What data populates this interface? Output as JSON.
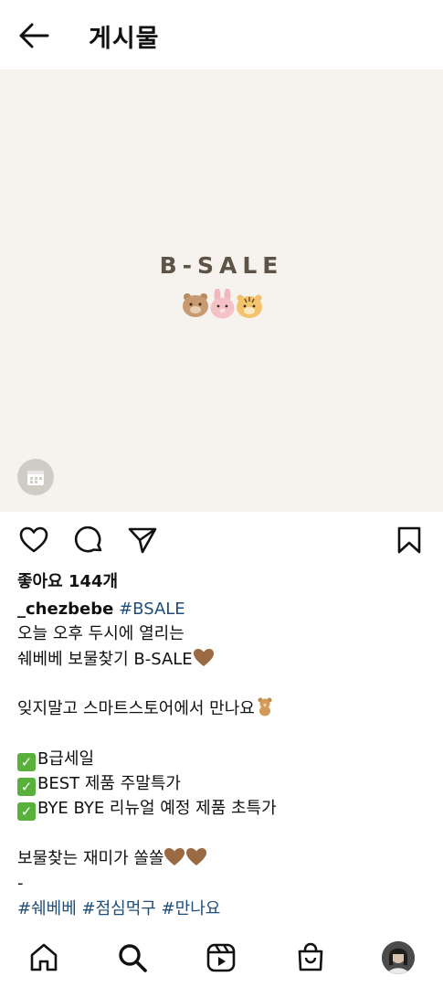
{
  "header": {
    "title": "게시물"
  },
  "post": {
    "image_text": "B-SALE",
    "likes": "좋아요 144개",
    "caption": {
      "username": "_chezbebe",
      "first_tag": "#BSALE",
      "line2": "오늘 오후 두시에 열리는",
      "line3": "쉐베베 보물찾기 B-SALE",
      "line5": "잊지말고 스마트스토어에서 만나요",
      "line7": "B급세일",
      "line8": "BEST 제품 주말특가",
      "line9": "BYE BYE 리뉴얼 예정 제품 초특가",
      "line11": "보물찾는 재미가 쏠쏠",
      "line12": "-",
      "tags": [
        "#쉐베베",
        "#점심먹구",
        "#만나요"
      ]
    }
  },
  "colors": {
    "background": "#ffffff",
    "image_bg": "#f6f3ee",
    "hashtag": "#1f4e79",
    "check": "#58b13a"
  },
  "icons": [
    "arrow-left-icon",
    "calendar-icon",
    "heart-icon",
    "comment-icon",
    "send-icon",
    "bookmark-icon",
    "home-icon",
    "search-icon",
    "reels-icon",
    "shop-icon",
    "profile-avatar"
  ]
}
